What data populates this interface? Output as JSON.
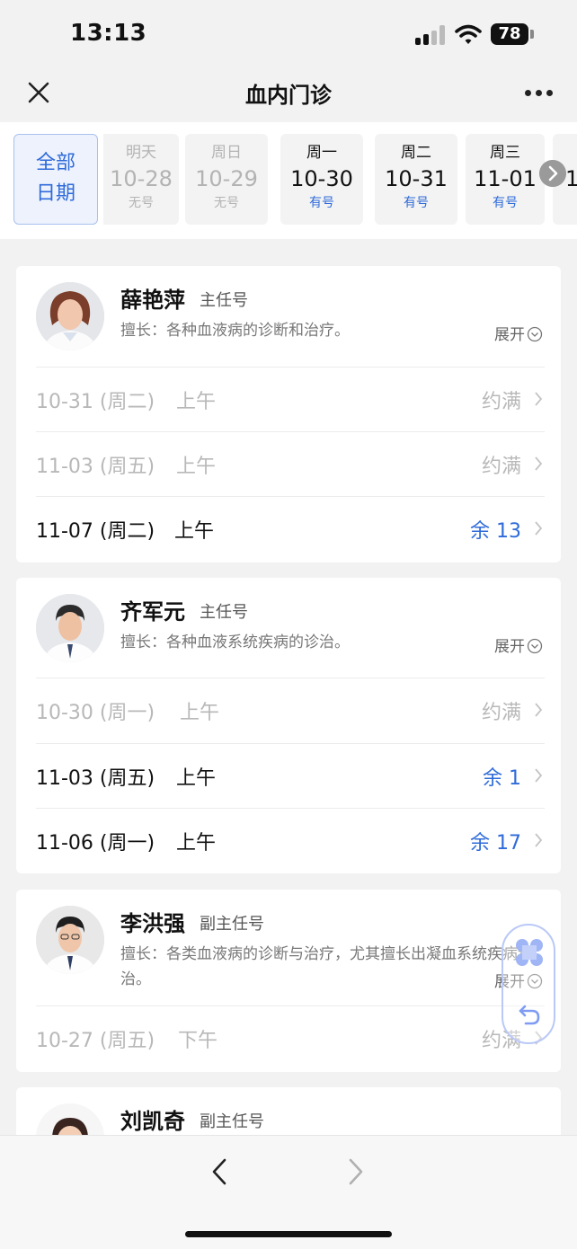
{
  "status": {
    "time": "13:13",
    "battery": "78"
  },
  "nav": {
    "title": "血内门诊"
  },
  "dates": {
    "all_label_1": "全部",
    "all_label_2": "日期",
    "items": [
      {
        "weekday": "明天",
        "date": "10-28",
        "status": "无号"
      },
      {
        "weekday": "周日",
        "date": "10-29",
        "status": "无号"
      },
      {
        "weekday": "周一",
        "date": "10-30",
        "status": "有号"
      },
      {
        "weekday": "周二",
        "date": "10-31",
        "status": "有号"
      },
      {
        "weekday": "周三",
        "date": "11-01",
        "status": "有号"
      },
      {
        "date_partial": "1"
      }
    ]
  },
  "doctors": [
    {
      "name": "薛艳萍",
      "rank": "主任号",
      "specialty": "擅长：各种血液病的诊断和治疗。",
      "expand": "展开",
      "slots": [
        {
          "date": "10-31 (周二)",
          "period": "上午",
          "status": "约满"
        },
        {
          "date": "11-03 (周五)",
          "period": "上午",
          "status": "约满"
        },
        {
          "date": "11-07 (周二)",
          "period": "上午",
          "status": "余 13"
        }
      ]
    },
    {
      "name": "齐军元",
      "rank": "主任号",
      "specialty": "擅长：各种血液系统疾病的诊治。",
      "expand": "展开",
      "slots": [
        {
          "date": "10-30 (周一)",
          "period": "上午",
          "status": "约满"
        },
        {
          "date": "11-03 (周五)",
          "period": "上午",
          "status": "余 1"
        },
        {
          "date": "11-06 (周一)",
          "period": "上午",
          "status": "余 17"
        }
      ]
    },
    {
      "name": "李洪强",
      "rank": "副主任号",
      "specialty": "擅长：各类血液病的诊断与治疗，尤其擅长出凝血系统疾病诊治。",
      "expand": "展开",
      "slots": [
        {
          "date": "10-27 (周五)",
          "period": "下午",
          "status": "约满"
        }
      ]
    },
    {
      "name": "刘凯奇",
      "rank": "副主任号"
    }
  ],
  "icons": {
    "close": "close-icon",
    "more": "more-icon",
    "next": "chevron-right-icon",
    "back": "back-arrow-icon",
    "forward": "forward-arrow-icon"
  },
  "colors": {
    "accent": "#2f6bd9",
    "disabled": "#b8b8b8"
  }
}
